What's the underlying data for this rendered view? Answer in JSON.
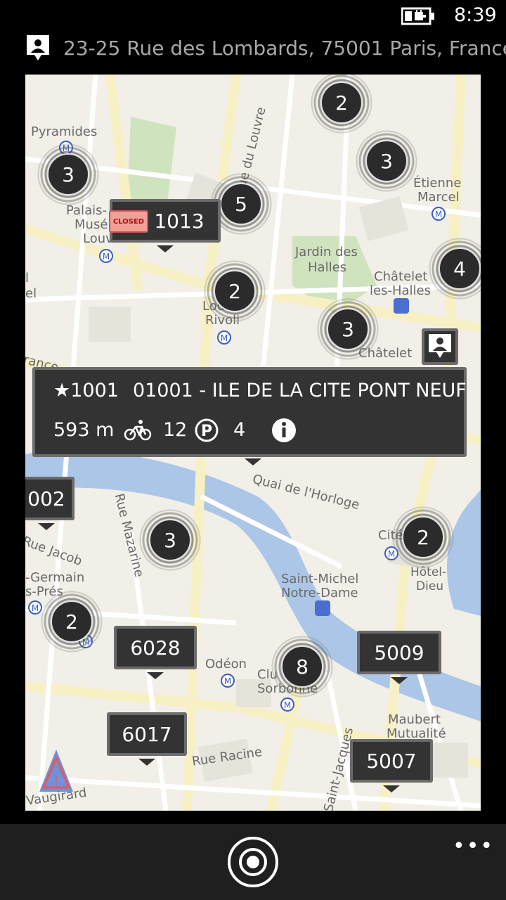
{
  "status_bar": {
    "time": "8:39",
    "battery_icon": "battery-charging-icon"
  },
  "address": {
    "icon": "contact-pin-icon",
    "text": "23-25 Rue des Lombards, 75001 Paris, France"
  },
  "map": {
    "labels": {
      "pyramides": "Pyramides",
      "palais": "Palais-",
      "muse": "Musé",
      "louv": "Louv",
      "louvre_rivoli_1": "Lou",
      "louvre_rivoli_2": "Rivoli",
      "rue_du_louvre": "Rue du Louvre",
      "etienne": "Étienne",
      "marcel": "Marcel",
      "jardin_1": "Jardin des",
      "jardin_2": "Halles",
      "chatelet_1": "Châtelet",
      "chatelet_2": "les-Halles",
      "chatelet": "Châtelet",
      "quai": "Quai de l'Horloge",
      "rue_jacob": "Rue Jacob",
      "rue_mazarine": "Rue Mazarine",
      "germain": "-Germain",
      "pres": "s-Prés",
      "saint_michel_1": "Saint-Michel",
      "saint_michel_2": "Notre-Dame",
      "cite": "Cité",
      "hotel_1": "Hôtel-",
      "hotel_2": "Dieu",
      "odeon": "Odéon",
      "cluny_1": "Clu",
      "cluny_2": "Sorbonne",
      "maubert_1": "Maubert",
      "maubert_2": "Mutualité",
      "rue_racine": "Rue Racine",
      "saint_jacques": "Saint-Jacques",
      "vaugirard": "Vaugirard",
      "left_l": "l",
      "left_el": "el",
      "france_cut": "rance"
    },
    "clusters": [
      {
        "count": "3"
      },
      {
        "count": "2"
      },
      {
        "count": "3"
      },
      {
        "count": "5"
      },
      {
        "count": "4"
      },
      {
        "count": "2"
      },
      {
        "count": "3"
      },
      {
        "count": "3"
      },
      {
        "count": "2"
      },
      {
        "count": "2"
      },
      {
        "count": "8"
      }
    ],
    "stations": {
      "s1013": "1013",
      "s002": "002",
      "s6028": "6028",
      "s6017": "6017",
      "s5009": "5009",
      "s5007": "5007"
    },
    "closed_badge": "CLOSED"
  },
  "popup": {
    "star": "★",
    "number": "1001",
    "name": "01001 - ILE DE LA CITE PONT NEUF",
    "distance": "593 m",
    "bikes": "12",
    "parking": "4",
    "bike_icon": "bicycle-icon",
    "parking_icon": "parking-icon",
    "info_icon": "info-icon"
  },
  "app_bar": {
    "locate_icon": "locate-me-icon",
    "more": "•••"
  },
  "colors": {
    "map_background": "#f1efe8",
    "water": "#abc6e6",
    "park": "#cfe3bf",
    "marker": "#333333"
  }
}
